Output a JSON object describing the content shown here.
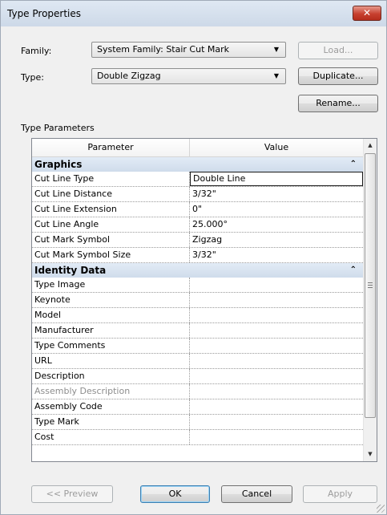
{
  "window": {
    "title": "Type Properties",
    "close_label": "✕"
  },
  "family": {
    "label": "Family:",
    "value": "System Family: Stair Cut Mark"
  },
  "type": {
    "label": "Type:",
    "value": "Double Zigzag"
  },
  "buttons": {
    "load": "Load...",
    "duplicate": "Duplicate...",
    "rename": "Rename...",
    "preview": "<< Preview",
    "ok": "OK",
    "cancel": "Cancel",
    "apply": "Apply"
  },
  "section_label": "Type Parameters",
  "columns": {
    "parameter": "Parameter",
    "value": "Value"
  },
  "groups": [
    {
      "name": "Graphics",
      "rows": [
        {
          "param": "Cut Line Type",
          "value": "Double Line"
        },
        {
          "param": "Cut Line Distance",
          "value": "3/32\""
        },
        {
          "param": "Cut Line Extension",
          "value": "0\""
        },
        {
          "param": "Cut Line Angle",
          "value": "25.000°"
        },
        {
          "param": "Cut Mark Symbol",
          "value": "Zigzag"
        },
        {
          "param": "Cut Mark Symbol Size",
          "value": "3/32\""
        }
      ]
    },
    {
      "name": "Identity Data",
      "rows": [
        {
          "param": "Type Image",
          "value": ""
        },
        {
          "param": "Keynote",
          "value": ""
        },
        {
          "param": "Model",
          "value": ""
        },
        {
          "param": "Manufacturer",
          "value": ""
        },
        {
          "param": "Type Comments",
          "value": ""
        },
        {
          "param": "URL",
          "value": ""
        },
        {
          "param": "Description",
          "value": ""
        },
        {
          "param": "Assembly Description",
          "value": ""
        },
        {
          "param": "Assembly Code",
          "value": ""
        },
        {
          "param": "Type Mark",
          "value": ""
        },
        {
          "param": "Cost",
          "value": ""
        }
      ]
    }
  ],
  "icons": {
    "dropdown": "chevron-down-icon",
    "collapse": "double-chevron-up-icon",
    "scroll_up": "arrow-up-icon",
    "scroll_down": "arrow-down-icon"
  }
}
